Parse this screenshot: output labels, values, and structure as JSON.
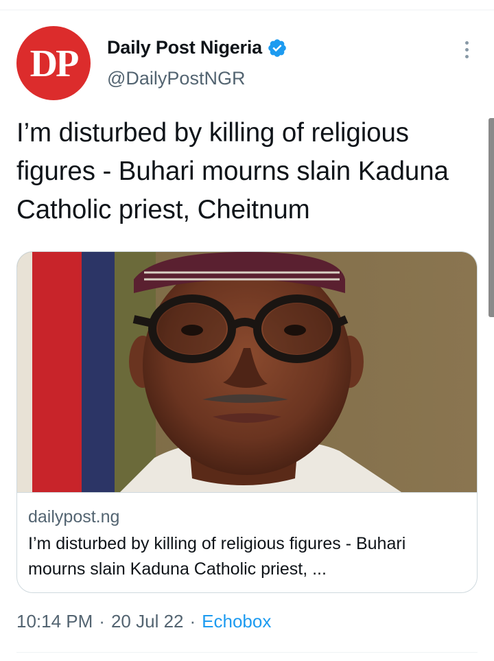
{
  "author": {
    "avatar_text": "DP",
    "display_name": "Daily Post Nigeria",
    "handle": "@DailyPostNGR",
    "verified": true,
    "avatar_color": "#dc2c2c"
  },
  "tweet": {
    "text": "I’m disturbed by killing of religious figures - Buhari mourns slain Kaduna Catholic priest, Cheitnum"
  },
  "card": {
    "domain": "dailypost.ng",
    "title": "I’m disturbed by killing of religious figures - Buhari mourns slain Kaduna Catholic priest, ..."
  },
  "meta": {
    "time": "10:14 PM",
    "separator": "·",
    "date": "20 Jul 22",
    "source": "Echobox"
  },
  "icons": {
    "verified": "verified-badge-icon",
    "more": "more-options-icon"
  },
  "colors": {
    "accent": "#1d9bf0",
    "secondary_text": "#536471",
    "primary_text": "#0f1419"
  }
}
